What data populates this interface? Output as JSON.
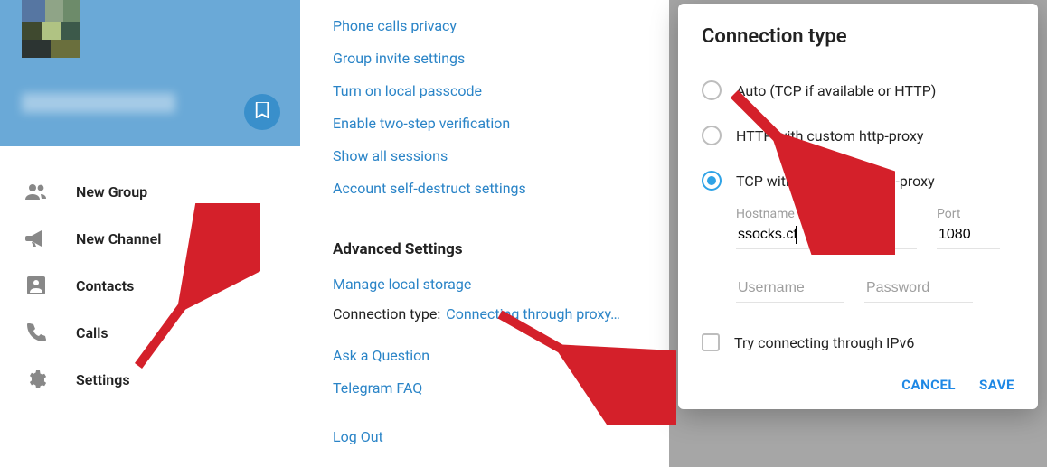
{
  "sidebar": {
    "menu": [
      {
        "label": "New Group",
        "icon": "people-icon"
      },
      {
        "label": "New Channel",
        "icon": "megaphone-icon"
      },
      {
        "label": "Contacts",
        "icon": "person-icon"
      },
      {
        "label": "Calls",
        "icon": "phone-icon"
      },
      {
        "label": "Settings",
        "icon": "gear-icon"
      }
    ]
  },
  "privacy_links": [
    "Phone calls privacy",
    "Group invite settings",
    "Turn on local passcode",
    "Enable two-step verification",
    "Show all sessions",
    "Account self-destruct settings"
  ],
  "advanced": {
    "title": "Advanced Settings",
    "manage_storage": "Manage local storage",
    "connection_label": "Connection type:",
    "connection_value": "Connecting through proxy…",
    "ask": "Ask a Question",
    "faq": "Telegram FAQ",
    "logout": "Log Out"
  },
  "dialog": {
    "title": "Connection type",
    "options": [
      "Auto (TCP if available or HTTP)",
      "HTTP with custom http-proxy",
      "TCP with custom socks5-proxy"
    ],
    "selected_index": 2,
    "hostname_label": "Hostname",
    "hostname_value": "ssocks.cf",
    "port_label": "Port",
    "port_value": "1080",
    "username_placeholder": "Username",
    "password_placeholder": "Password",
    "ipv6_label": "Try connecting through IPv6",
    "cancel": "CANCEL",
    "save": "SAVE"
  },
  "colors": {
    "accent": "#2a84c7",
    "dialog_accent": "#1e88e5",
    "header": "#6aa9d7"
  }
}
